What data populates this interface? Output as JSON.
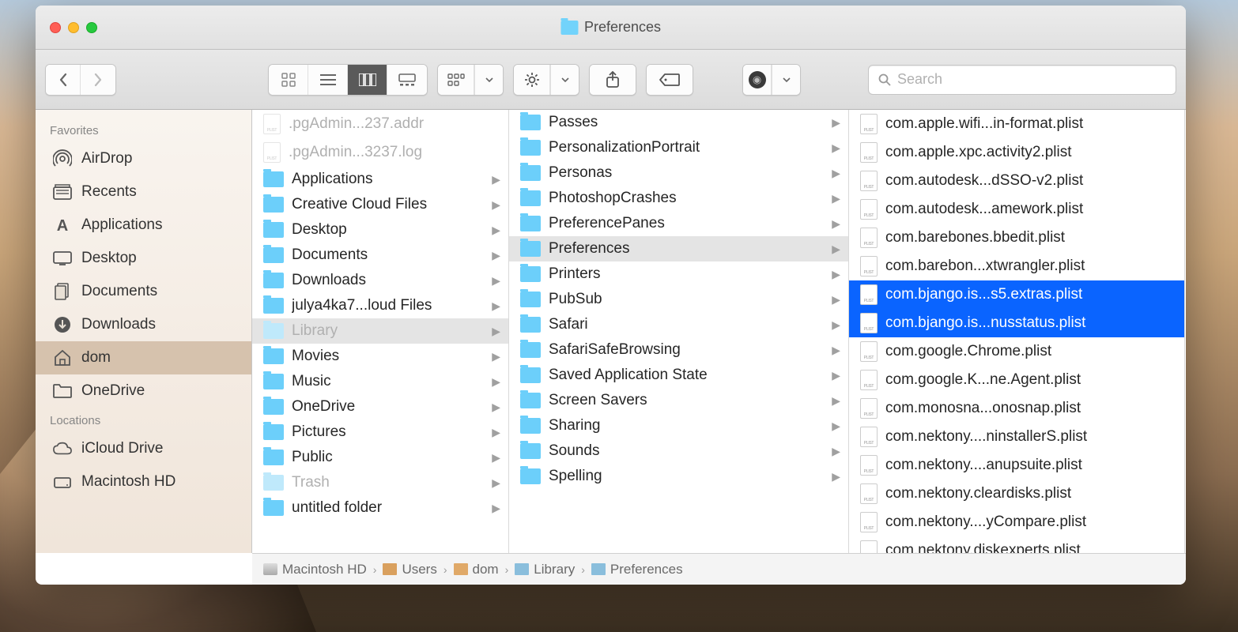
{
  "window": {
    "title": "Preferences"
  },
  "toolbar": {
    "search_placeholder": "Search"
  },
  "sidebar": {
    "sections": [
      {
        "heading": "Favorites",
        "items": [
          {
            "icon": "airdrop",
            "label": "AirDrop"
          },
          {
            "icon": "recents",
            "label": "Recents"
          },
          {
            "icon": "apps",
            "label": "Applications"
          },
          {
            "icon": "desktop",
            "label": "Desktop"
          },
          {
            "icon": "documents",
            "label": "Documents"
          },
          {
            "icon": "downloads",
            "label": "Downloads"
          },
          {
            "icon": "home",
            "label": "dom",
            "active": true
          },
          {
            "icon": "folder",
            "label": "OneDrive"
          }
        ]
      },
      {
        "heading": "Locations",
        "items": [
          {
            "icon": "icloud",
            "label": "iCloud Drive"
          },
          {
            "icon": "disk",
            "label": "Macintosh HD"
          }
        ]
      }
    ]
  },
  "columns": [
    {
      "items": [
        {
          "type": "file",
          "label": ".pgAdmin...237.addr",
          "dim": true
        },
        {
          "type": "file",
          "label": ".pgAdmin...3237.log",
          "dim": true
        },
        {
          "type": "folder",
          "label": "Applications",
          "chev": true
        },
        {
          "type": "folder",
          "label": "Creative Cloud Files",
          "chev": true
        },
        {
          "type": "folder",
          "label": "Desktop",
          "chev": true
        },
        {
          "type": "folder",
          "label": "Documents",
          "chev": true
        },
        {
          "type": "folder",
          "label": "Downloads",
          "chev": true
        },
        {
          "type": "folder",
          "label": "julya4ka7...loud Files",
          "chev": true
        },
        {
          "type": "folder",
          "label": "Library",
          "chev": true,
          "selpath": true,
          "dimfolder": true
        },
        {
          "type": "folder",
          "label": "Movies",
          "chev": true
        },
        {
          "type": "folder",
          "label": "Music",
          "chev": true
        },
        {
          "type": "folder",
          "label": "OneDrive",
          "chev": true
        },
        {
          "type": "folder",
          "label": "Pictures",
          "chev": true
        },
        {
          "type": "folder",
          "label": "Public",
          "chev": true
        },
        {
          "type": "folder",
          "label": "Trash",
          "chev": true,
          "dimfolder": true
        },
        {
          "type": "folder",
          "label": "untitled folder",
          "chev": true
        }
      ]
    },
    {
      "items": [
        {
          "type": "folder",
          "label": "Passes",
          "chev": true
        },
        {
          "type": "folder",
          "label": "PersonalizationPortrait",
          "chev": true
        },
        {
          "type": "folder",
          "label": "Personas",
          "chev": true
        },
        {
          "type": "folder",
          "label": "PhotoshopCrashes",
          "chev": true
        },
        {
          "type": "folder",
          "label": "PreferencePanes",
          "chev": true
        },
        {
          "type": "folder",
          "label": "Preferences",
          "chev": true,
          "selpath": true
        },
        {
          "type": "folder",
          "label": "Printers",
          "chev": true
        },
        {
          "type": "folder",
          "label": "PubSub",
          "chev": true
        },
        {
          "type": "folder",
          "label": "Safari",
          "chev": true
        },
        {
          "type": "folder",
          "label": "SafariSafeBrowsing",
          "chev": true
        },
        {
          "type": "folder",
          "label": "Saved Application State",
          "chev": true
        },
        {
          "type": "folder",
          "label": "Screen Savers",
          "chev": true
        },
        {
          "type": "folder",
          "label": "Sharing",
          "chev": true
        },
        {
          "type": "folder",
          "label": "Sounds",
          "chev": true
        },
        {
          "type": "folder",
          "label": "Spelling",
          "chev": true
        }
      ]
    },
    {
      "items": [
        {
          "type": "plist",
          "label": "com.apple.wifi...in-format.plist"
        },
        {
          "type": "plist",
          "label": "com.apple.xpc.activity2.plist"
        },
        {
          "type": "plist",
          "label": "com.autodesk...dSSO-v2.plist"
        },
        {
          "type": "plist",
          "label": "com.autodesk...amework.plist"
        },
        {
          "type": "plist",
          "label": "com.barebones.bbedit.plist"
        },
        {
          "type": "plist",
          "label": "com.barebon...xtwrangler.plist"
        },
        {
          "type": "plist",
          "label": "com.bjango.is...s5.extras.plist",
          "selected": true
        },
        {
          "type": "plist",
          "label": "com.bjango.is...nusstatus.plist",
          "selected": true
        },
        {
          "type": "plist",
          "label": "com.google.Chrome.plist"
        },
        {
          "type": "plist",
          "label": "com.google.K...ne.Agent.plist"
        },
        {
          "type": "plist",
          "label": "com.monosna...onosnap.plist"
        },
        {
          "type": "plist",
          "label": "com.nektony....ninstallerS.plist"
        },
        {
          "type": "plist",
          "label": "com.nektony....anupsuite.plist"
        },
        {
          "type": "plist",
          "label": "com.nektony.cleardisks.plist"
        },
        {
          "type": "plist",
          "label": "com.nektony....yCompare.plist"
        },
        {
          "type": "plist",
          "label": "com.nektony.diskexperts.plist"
        }
      ]
    }
  ],
  "pathbar": [
    {
      "icon": "disk",
      "label": "Macintosh HD"
    },
    {
      "icon": "user",
      "label": "Users"
    },
    {
      "icon": "home",
      "label": "dom"
    },
    {
      "icon": "folder",
      "label": "Library"
    },
    {
      "icon": "folder",
      "label": "Preferences"
    }
  ]
}
